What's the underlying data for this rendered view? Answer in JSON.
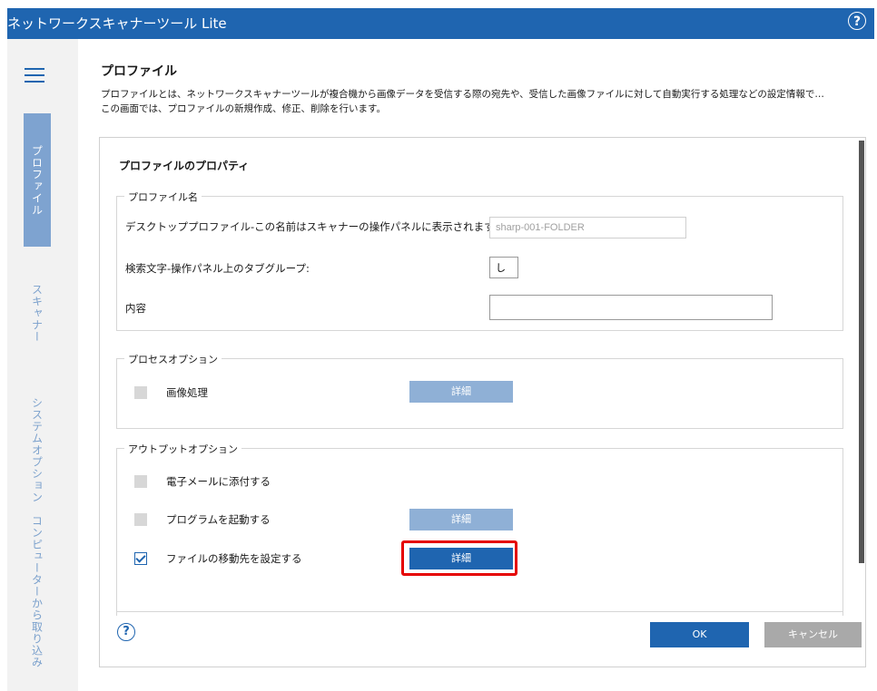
{
  "app": {
    "title": "ネットワークスキャナーツール Lite",
    "help_icon": "?"
  },
  "nav": {
    "items": [
      {
        "label": "プロファイル",
        "active": true
      },
      {
        "label": "スキャナー",
        "active": false
      },
      {
        "label": "システムオプション",
        "active": false
      },
      {
        "label": "コンピューターから取り込み",
        "active": false
      }
    ]
  },
  "header": {
    "title": "プロファイル",
    "description_line1": "プロファイルとは、ネットワークスキャナーツールが複合機から画像データを受信する際の宛先や、受信した画像ファイルに対して自動実行する処理などの設定情報で…",
    "description_line2": "この画面では、プロファイルの新規作成、修正、削除を行います。"
  },
  "dialog": {
    "title": "プロファイルのプロパティ",
    "profile_name_group": {
      "legend": "プロファイル名",
      "desktop_profile_label": "デスクトッププロファイル-この名前はスキャナーの操作パネルに表示されます。",
      "desktop_profile_value": "sharp-001-FOLDER",
      "search_label": "検索文字-操作パネル上のタブグループ:",
      "search_value": "し",
      "content_label": "内容",
      "content_value": ""
    },
    "process_group": {
      "legend": "プロセスオプション",
      "image_processing_label": "画像処理",
      "detail_label": "詳細"
    },
    "output_group": {
      "legend": "アウトプットオプション",
      "email_label": "電子メールに添付する",
      "program_label": "プログラムを起動する",
      "program_detail_label": "詳細",
      "file_move_label": "ファイルの移動先を設定する",
      "file_move_detail_label": "詳細",
      "file_move_checked": true
    },
    "footer": {
      "help_icon": "?",
      "ok_label": "OK",
      "cancel_label": "キャンセル"
    }
  }
}
